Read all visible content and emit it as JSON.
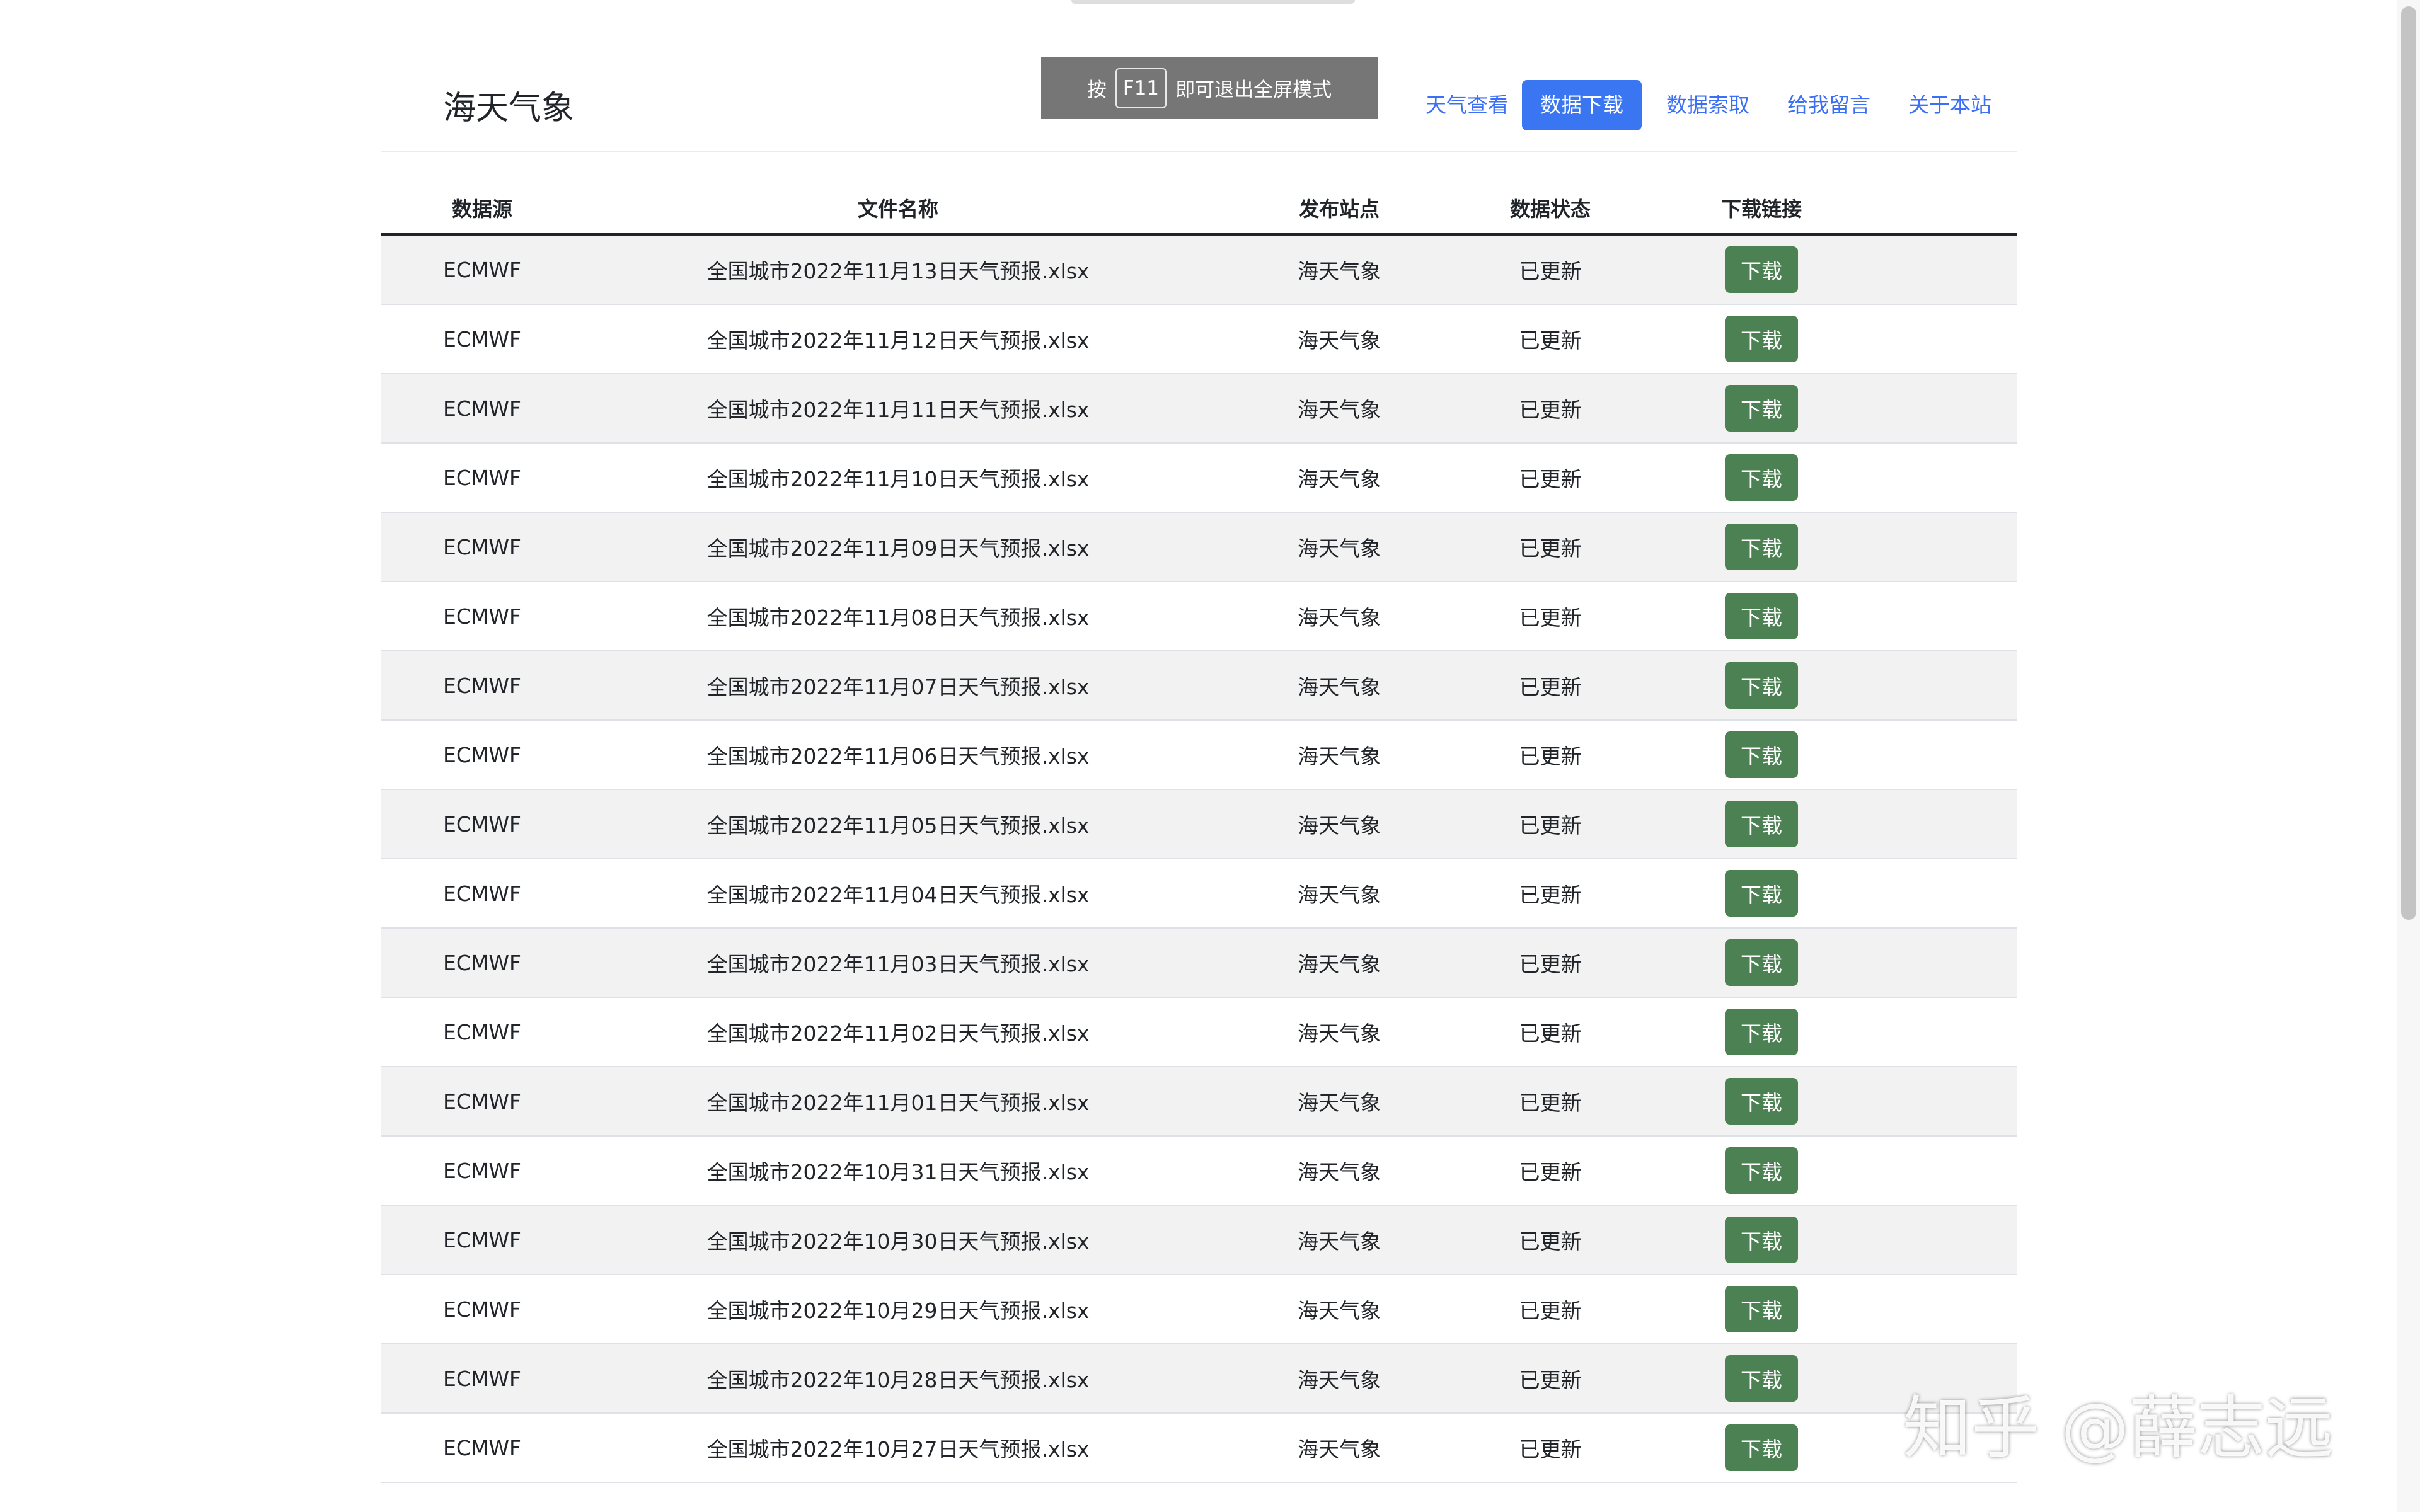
{
  "brand": "海天气象",
  "nav": [
    {
      "label": "天气查看",
      "active": false
    },
    {
      "label": "数据下载",
      "active": true
    },
    {
      "label": "数据索取",
      "active": false
    },
    {
      "label": "给我留言",
      "active": false
    },
    {
      "label": "关于本站",
      "active": false
    }
  ],
  "fullscreen_notice": {
    "prefix": "按",
    "key": "F11",
    "suffix": "即可退出全屏模式"
  },
  "table": {
    "headers": [
      "数据源",
      "文件名称",
      "发布站点",
      "数据状态",
      "下载链接"
    ],
    "download_label": "下载",
    "rows": [
      {
        "source": "ECMWF",
        "file": "全国城市2022年11月13日天气预报.xlsx",
        "station": "海天气象",
        "status": "已更新"
      },
      {
        "source": "ECMWF",
        "file": "全国城市2022年11月12日天气预报.xlsx",
        "station": "海天气象",
        "status": "已更新"
      },
      {
        "source": "ECMWF",
        "file": "全国城市2022年11月11日天气预报.xlsx",
        "station": "海天气象",
        "status": "已更新"
      },
      {
        "source": "ECMWF",
        "file": "全国城市2022年11月10日天气预报.xlsx",
        "station": "海天气象",
        "status": "已更新"
      },
      {
        "source": "ECMWF",
        "file": "全国城市2022年11月09日天气预报.xlsx",
        "station": "海天气象",
        "status": "已更新"
      },
      {
        "source": "ECMWF",
        "file": "全国城市2022年11月08日天气预报.xlsx",
        "station": "海天气象",
        "status": "已更新"
      },
      {
        "source": "ECMWF",
        "file": "全国城市2022年11月07日天气预报.xlsx",
        "station": "海天气象",
        "status": "已更新"
      },
      {
        "source": "ECMWF",
        "file": "全国城市2022年11月06日天气预报.xlsx",
        "station": "海天气象",
        "status": "已更新"
      },
      {
        "source": "ECMWF",
        "file": "全国城市2022年11月05日天气预报.xlsx",
        "station": "海天气象",
        "status": "已更新"
      },
      {
        "source": "ECMWF",
        "file": "全国城市2022年11月04日天气预报.xlsx",
        "station": "海天气象",
        "status": "已更新"
      },
      {
        "source": "ECMWF",
        "file": "全国城市2022年11月03日天气预报.xlsx",
        "station": "海天气象",
        "status": "已更新"
      },
      {
        "source": "ECMWF",
        "file": "全国城市2022年11月02日天气预报.xlsx",
        "station": "海天气象",
        "status": "已更新"
      },
      {
        "source": "ECMWF",
        "file": "全国城市2022年11月01日天气预报.xlsx",
        "station": "海天气象",
        "status": "已更新"
      },
      {
        "source": "ECMWF",
        "file": "全国城市2022年10月31日天气预报.xlsx",
        "station": "海天气象",
        "status": "已更新"
      },
      {
        "source": "ECMWF",
        "file": "全国城市2022年10月30日天气预报.xlsx",
        "station": "海天气象",
        "status": "已更新"
      },
      {
        "source": "ECMWF",
        "file": "全国城市2022年10月29日天气预报.xlsx",
        "station": "海天气象",
        "status": "已更新"
      },
      {
        "source": "ECMWF",
        "file": "全国城市2022年10月28日天气预报.xlsx",
        "station": "海天气象",
        "status": "已更新"
      },
      {
        "source": "ECMWF",
        "file": "全国城市2022年10月27日天气预报.xlsx",
        "station": "海天气象",
        "status": "已更新"
      }
    ]
  },
  "watermark": "知乎 @薛志远",
  "colors": {
    "primary": "#3b76f2",
    "download_button": "#4c8253",
    "stripe": "#f2f2f2"
  }
}
